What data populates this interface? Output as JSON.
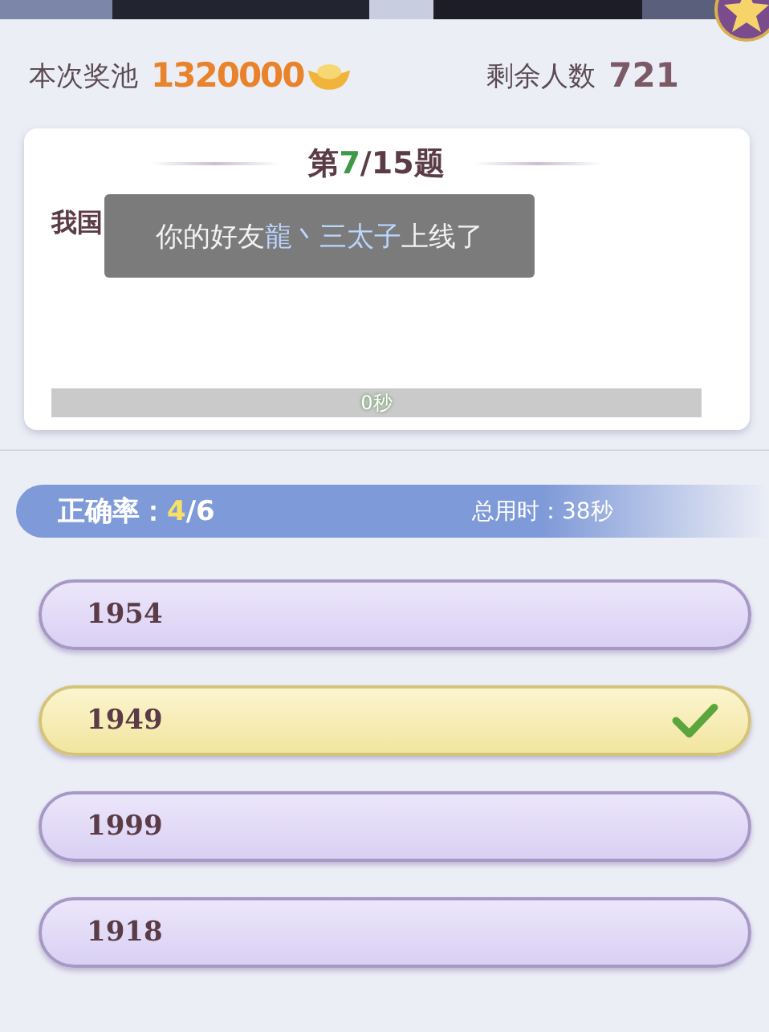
{
  "header": {
    "pool_label": "本次奖池",
    "pool_value": "1320000",
    "remaining_label": "剩余人数",
    "remaining_value": "721"
  },
  "question": {
    "title_prefix": "第",
    "current": "7",
    "title_suffix": "/15题",
    "text": "我国",
    "timer": {
      "level": 0,
      "reading": "0秒"
    }
  },
  "toast": {
    "prefix": "你的好友",
    "friend": "龍丶三太子",
    "suffix": "上线了"
  },
  "stats": {
    "accuracy_label": "正确率：",
    "correct": "4",
    "total": "/6",
    "time_label": "总用时：",
    "time_value": "38秒"
  },
  "options": [
    {
      "label": "1954",
      "selected": false
    },
    {
      "label": "1949",
      "selected": true
    },
    {
      "label": "1999",
      "selected": false
    },
    {
      "label": "1918",
      "selected": false
    }
  ]
}
